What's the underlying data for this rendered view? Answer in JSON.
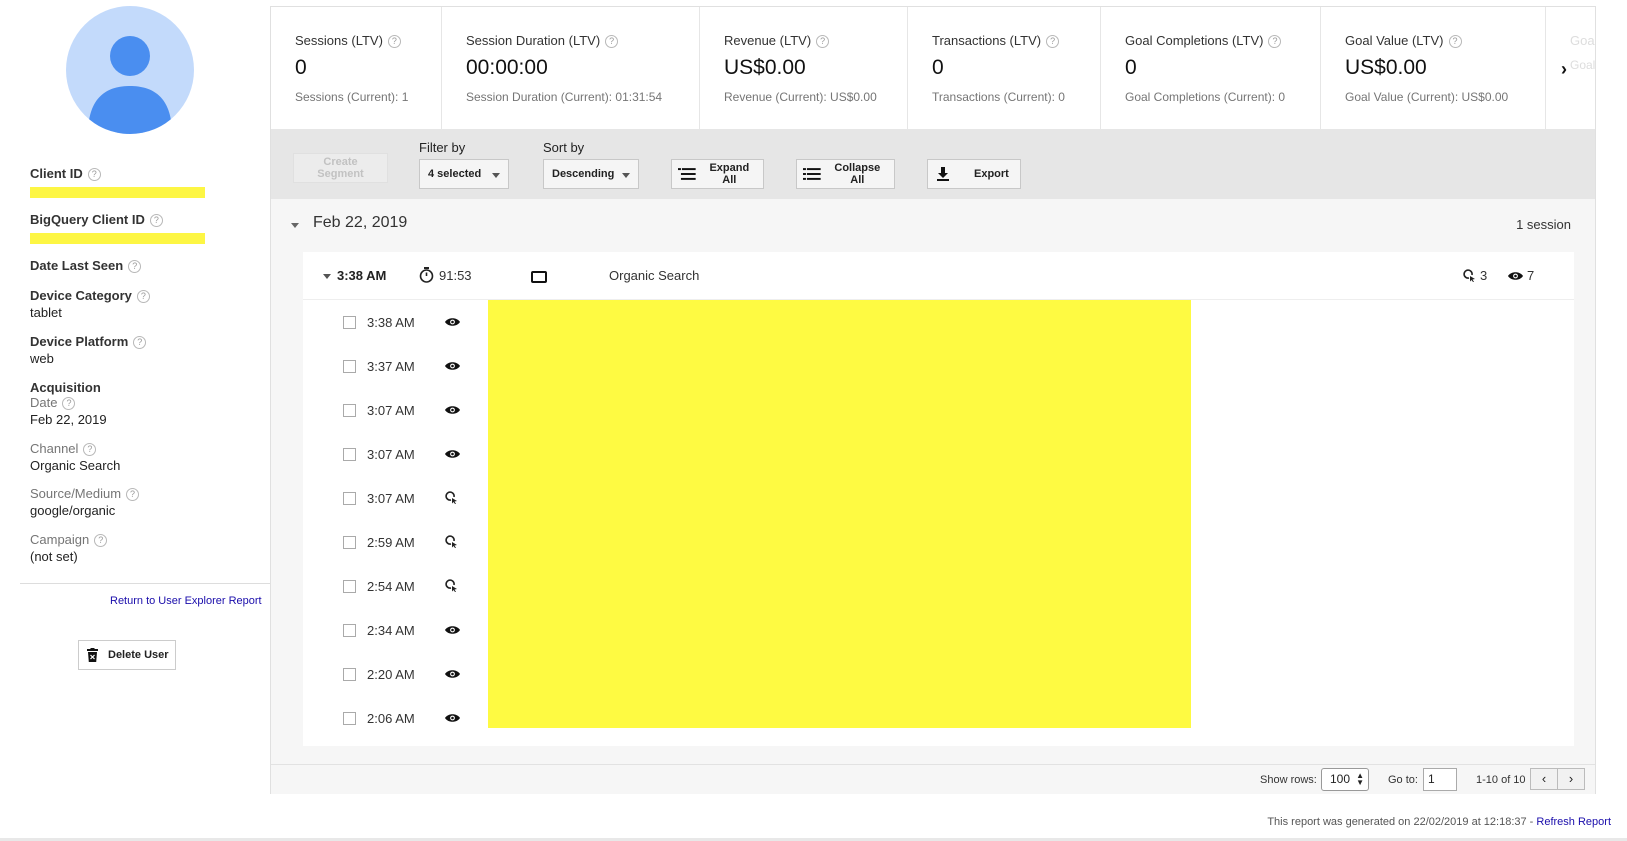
{
  "sidebar": {
    "client_id_label": "Client ID",
    "bigquery_id_label": "BigQuery Client ID",
    "date_last_seen_label": "Date Last Seen",
    "device_category_label": "Device Category",
    "device_category_value": "tablet",
    "device_platform_label": "Device Platform",
    "device_platform_value": "web",
    "acquisition_label": "Acquisition",
    "acq_date_label": "Date",
    "acq_date_value": "Feb 22, 2019",
    "channel_label": "Channel",
    "channel_value": "Organic Search",
    "source_medium_label": "Source/Medium",
    "source_medium_value": "google/organic",
    "campaign_label": "Campaign",
    "campaign_value": "(not set)",
    "return_link": "Return to User Explorer Report",
    "delete_button": "Delete User",
    "help_glyph": "?"
  },
  "metrics": [
    {
      "title": "Sessions (LTV)",
      "value": "0",
      "current": "Sessions (Current): 1"
    },
    {
      "title": "Session Duration (LTV)",
      "value": "00:00:00",
      "current": "Session Duration (Current): 01:31:54"
    },
    {
      "title": "Revenue (LTV)",
      "value": "US$0.00",
      "current": "Revenue (Current): US$0.00"
    },
    {
      "title": "Transactions (LTV)",
      "value": "0",
      "current": "Transactions (Current): 0"
    },
    {
      "title": "Goal Completions (LTV)",
      "value": "0",
      "current": "Goal Completions (Current): 0"
    },
    {
      "title": "Goal Value (LTV)",
      "value": "US$0.00",
      "current": "Goal Value (Current): US$0.00"
    },
    {
      "title": "Goal",
      "value": "",
      "current": "Goal"
    }
  ],
  "toolbar": {
    "create_segment": "Create Segment",
    "filter_label": "Filter by",
    "filter_value": "4 selected",
    "sort_label": "Sort by",
    "sort_value": "Descending",
    "expand_all": "Expand All",
    "collapse_all": "Collapse All",
    "export": "Export"
  },
  "timeline": {
    "date": "Feb 22, 2019",
    "session_count": "1 session",
    "session": {
      "time": "3:38 AM",
      "duration": "91:53",
      "channel": "Organic Search",
      "goals": "3",
      "views": "7"
    },
    "hits": [
      {
        "time": "3:38 AM",
        "icon": "pageview-eye-icon"
      },
      {
        "time": "3:37 AM",
        "icon": "pageview-eye-icon"
      },
      {
        "time": "3:07 AM",
        "icon": "pageview-eye-icon"
      },
      {
        "time": "3:07 AM",
        "icon": "pageview-eye-icon"
      },
      {
        "time": "3:07 AM",
        "icon": "goal-flag-icon"
      },
      {
        "time": "2:59 AM",
        "icon": "goal-flag-icon"
      },
      {
        "time": "2:54 AM",
        "icon": "goal-flag-icon"
      },
      {
        "time": "2:34 AM",
        "icon": "pageview-eye-icon"
      },
      {
        "time": "2:20 AM",
        "icon": "pageview-eye-icon"
      },
      {
        "time": "2:06 AM",
        "icon": "pageview-eye-icon"
      }
    ]
  },
  "pagination": {
    "show_rows_label": "Show rows:",
    "rows_value": "100",
    "goto_label": "Go to:",
    "goto_value": "1",
    "range": "1-10 of 10",
    "prev": "‹",
    "next": "›"
  },
  "footer": {
    "generated_text": "This report was generated on 22/02/2019 at 12:18:37 - ",
    "refresh_link": "Refresh Report"
  },
  "colors": {
    "redaction": "#fefa42",
    "link": "#1a0dab",
    "avatar_bg": "#c3dafb",
    "avatar_fg": "#4a8ef0"
  }
}
